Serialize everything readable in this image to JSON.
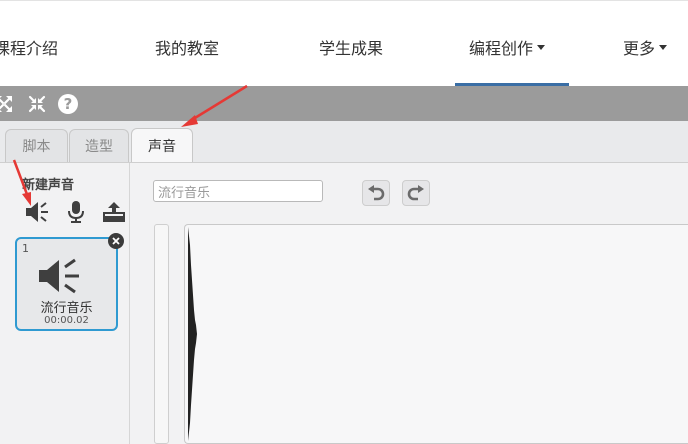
{
  "nav": {
    "items": [
      {
        "label": "课程介绍",
        "has_caret": false
      },
      {
        "label": "我的教室",
        "has_caret": false
      },
      {
        "label": "学生成果",
        "has_caret": false
      },
      {
        "label": "编程创作",
        "has_caret": true,
        "active": true
      },
      {
        "label": "更多",
        "has_caret": true
      }
    ],
    "active_color": "#3a6ea5"
  },
  "toolbar": {
    "icons": [
      "fullscreen-icon",
      "small-stage-icon",
      "help-icon"
    ],
    "help_label": "?"
  },
  "tabs": [
    {
      "label": "脚本",
      "active": false
    },
    {
      "label": "造型",
      "active": false
    },
    {
      "label": "声音",
      "active": true
    }
  ],
  "sounds_panel": {
    "new_sound_label": "新建声音",
    "new_sound_buttons": [
      "speaker-library-icon",
      "microphone-icon",
      "upload-icon"
    ],
    "sounds": [
      {
        "index": "1",
        "name": "流行音乐",
        "duration": "00:00.02",
        "selected": true
      }
    ]
  },
  "editor": {
    "sound_name_value": "流行音乐",
    "undo_icon": "undo-icon",
    "redo_icon": "redo-icon"
  },
  "colors": {
    "selected_border": "#2f9ad1",
    "annotation_arrow": "#e53935",
    "toolbar_gray": "#9b9b9b"
  }
}
